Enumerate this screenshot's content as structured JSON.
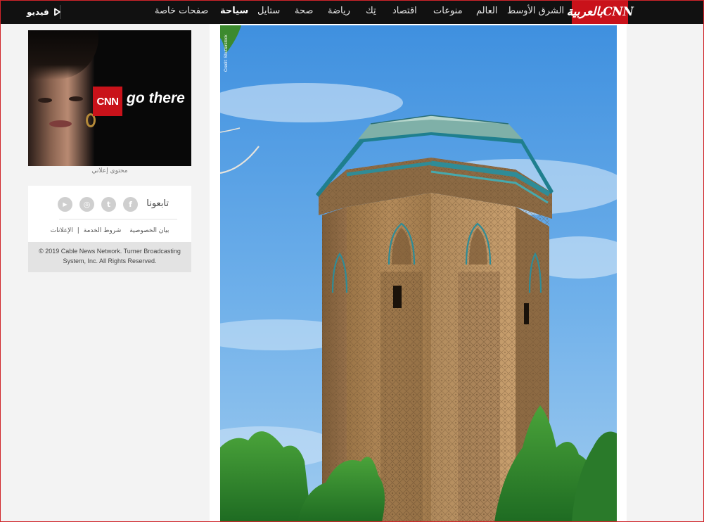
{
  "topbar": {
    "logo_text": "بالعربيةCNN",
    "nav": [
      {
        "label": "الشرق الأوسط",
        "active": false
      },
      {
        "label": "العالم",
        "active": false
      },
      {
        "label": "منوعات",
        "active": false
      },
      {
        "label": "اقتصاد",
        "active": false
      },
      {
        "label": "تِك",
        "active": false
      },
      {
        "label": "رياضة",
        "active": false
      },
      {
        "label": "صحة",
        "active": false
      },
      {
        "label": "ستايل",
        "active": false
      },
      {
        "label": "سياحة",
        "active": true
      },
      {
        "label": "صفحات خاصة",
        "active": false
      }
    ],
    "video_label": "فيديو",
    "accent_color": "#c9121a"
  },
  "sidebar": {
    "ad": {
      "logo": "CNN",
      "tagline": "go there",
      "caption": "محتوى إعلاني"
    },
    "follow": {
      "label": "تابعونا",
      "social": [
        {
          "icon": "facebook-icon",
          "glyph": "f"
        },
        {
          "icon": "twitter-icon",
          "glyph": "t"
        },
        {
          "icon": "instagram-icon",
          "glyph": "◎"
        },
        {
          "icon": "youtube-icon",
          "glyph": "▶"
        }
      ]
    },
    "links": [
      "بيان الخصوصية",
      "شروط الخدمة",
      "الإعلانات"
    ],
    "copyright": "© 2019 Cable News Network. Turner Broadcasting System, Inc. All Rights Reserved."
  },
  "article": {
    "image_subject": "octagonal brick tomb tower with turquoise tiled cornice against blue sky",
    "photo_credit": "Credit: Shutterstock"
  }
}
